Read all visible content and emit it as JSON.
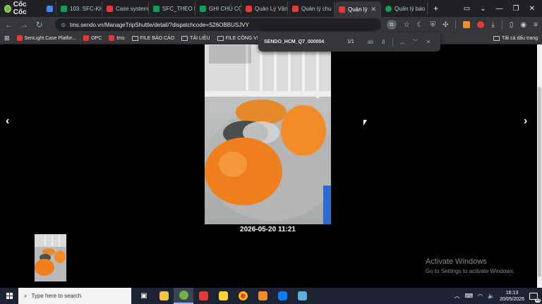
{
  "browser": {
    "brand": "Cốc Cốc",
    "tabs": [
      {
        "label": "",
        "color": "#4285f4",
        "active": false
      },
      {
        "label": "103. SFC-KH",
        "color": "#0f9d58",
        "active": false
      },
      {
        "label": "Case system",
        "color": "#e53935",
        "active": false
      },
      {
        "label": "SFC_THEO D",
        "color": "#0f9d58",
        "active": false
      },
      {
        "label": "GHI CHÚ CÓ",
        "color": "#0f9d58",
        "active": false
      },
      {
        "label": "Quản Lý Vận",
        "color": "#e53935",
        "active": false
      },
      {
        "label": "Quản lý chu",
        "color": "#e53935",
        "active": false
      },
      {
        "label": "Quản lý",
        "color": "#e53935",
        "active": true
      },
      {
        "label": "Quản lý báo",
        "color": "#0f9d58",
        "active": false
      }
    ],
    "new_tab": "+",
    "url": "tms.sendo.vn/ManageTripShuttle/detail/?dispatchcode=S26OBBUSJVY",
    "bookmarks": [
      {
        "label": "SenLight Case Platfor...",
        "type": "site",
        "color": "#e53935"
      },
      {
        "label": "OPC",
        "type": "site",
        "color": "#e53935"
      },
      {
        "label": "tms",
        "type": "site",
        "color": "#e53935"
      },
      {
        "label": "FILE BÁO CÁO",
        "type": "folder"
      },
      {
        "label": "TÀI LIỆU",
        "type": "folder"
      },
      {
        "label": "FILE CÔNG VIỆC",
        "type": "folder"
      }
    ],
    "all_bookmarks": "Tất cả dấu trang"
  },
  "find_bar": {
    "query": "SENDO_HCM_Q7_000004",
    "count": "1/1"
  },
  "viewer": {
    "prev": "‹",
    "next": "›",
    "timestamp": "2026-05-20 11:21"
  },
  "watermark": {
    "line1": "Activate Windows",
    "line2": "Go to Settings to activate Windows."
  },
  "taskbar": {
    "search_placeholder": "Type here to search",
    "apps": [
      {
        "name": "task-view",
        "color": "#4a5568"
      },
      {
        "name": "file-explorer",
        "color": "#f4c542"
      },
      {
        "name": "coccoc",
        "color": "#6db33f",
        "active": true
      },
      {
        "name": "wps",
        "color": "#e53935"
      },
      {
        "name": "sticky-notes",
        "color": "#f6d32d"
      },
      {
        "name": "chrome",
        "color": "#ea4335"
      },
      {
        "name": "app-orange",
        "color": "#f28c28"
      },
      {
        "name": "zalo",
        "color": "#0a7cff"
      },
      {
        "name": "app-blue",
        "color": "#5ab0d8"
      }
    ],
    "time": "16:13",
    "date": "20/05/2026",
    "notifications": "23"
  }
}
